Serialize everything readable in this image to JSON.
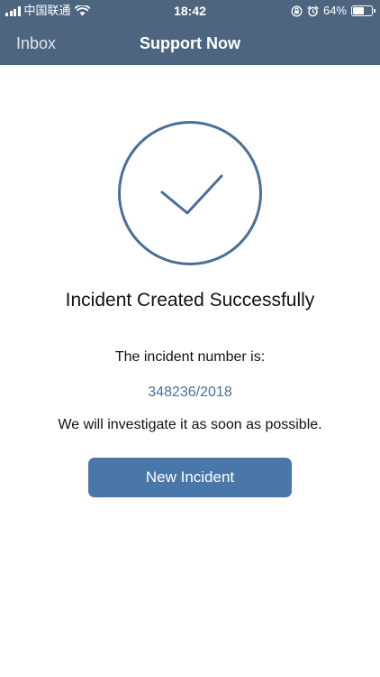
{
  "status_bar": {
    "carrier": "中国联通",
    "time": "18:42",
    "battery_percent": "64%",
    "battery_level": 0.64,
    "icons": [
      "signal-icon",
      "wifi-icon",
      "orientation-lock-icon",
      "alarm-icon",
      "battery-icon"
    ]
  },
  "nav": {
    "back_label": "Inbox",
    "title": "Support Now"
  },
  "result": {
    "icon": "checkmark-circle-icon",
    "title": "Incident Created Successfully",
    "number_label": "The incident number is:",
    "incident_number": "348236/2018",
    "message": "We will investigate it as soon as possible.",
    "button_label": "New Incident"
  },
  "colors": {
    "header": "#4e6580",
    "accent": "#4a77aa",
    "number_text": "#4a6f94"
  }
}
